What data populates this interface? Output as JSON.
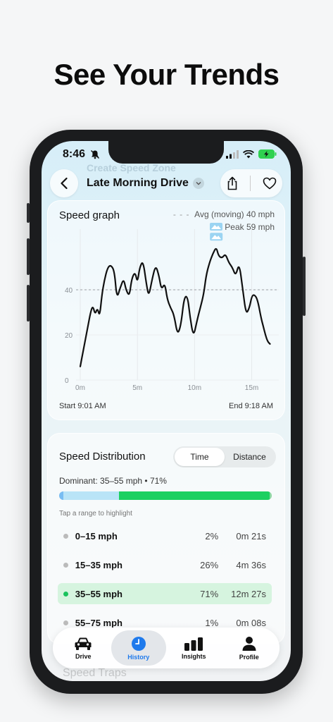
{
  "headline": "See Your Trends",
  "status": {
    "time": "8:46"
  },
  "ghost": {
    "top": "Create Speed Zone",
    "bottom": "Speed Traps"
  },
  "nav": {
    "title": "Late Morning Drive"
  },
  "graph": {
    "title": "Speed graph",
    "avg_label": "Avg (moving) 40 mph",
    "peak_label": "Peak 59 mph",
    "start_label": "Start 9:01 AM",
    "end_label": "End 9:18 AM"
  },
  "chart_data": {
    "type": "line",
    "xlabel": "",
    "ylabel": "",
    "x_ticks": [
      "0m",
      "5m",
      "10m",
      "15m"
    ],
    "y_ticks": [
      "0",
      "20",
      "40"
    ],
    "ylim": [
      0,
      60
    ],
    "xlim": [
      0,
      17
    ],
    "avg": 40,
    "peak": 59,
    "series": [
      {
        "x": [
          0,
          0.3,
          0.6,
          0.9,
          1.1,
          1.3,
          1.5,
          1.7,
          1.9,
          2.1,
          2.4,
          2.7,
          3.0,
          3.2,
          3.5,
          3.8,
          4.0,
          4.3,
          4.5,
          4.8,
          5.0,
          5.2,
          5.5,
          5.8,
          6.0,
          6.3,
          6.6,
          6.9,
          7.1,
          7.4,
          7.6,
          7.9,
          8.2,
          8.5,
          8.8,
          9.1,
          9.4,
          9.6,
          9.9,
          10.2,
          10.5,
          10.8,
          11.0,
          11.3,
          11.6,
          11.9,
          12.1,
          12.4,
          12.7,
          13.0,
          13.3,
          13.6,
          13.9,
          14.2,
          14.5,
          14.8,
          15.0,
          15.2,
          15.5,
          15.8,
          16.0,
          16.2,
          16.4,
          16.6
        ],
        "y": [
          6,
          14,
          22,
          30,
          33,
          29,
          32,
          28,
          38,
          44,
          50,
          51,
          48,
          36,
          41,
          45,
          40,
          37,
          45,
          48,
          43,
          50,
          53,
          42,
          37,
          45,
          51,
          46,
          40,
          43,
          36,
          32,
          29,
          20,
          24,
          37,
          37,
          28,
          19,
          26,
          32,
          38,
          46,
          52,
          56,
          59,
          55,
          54,
          56,
          52,
          50,
          46,
          52,
          41,
          29,
          32,
          37,
          38,
          36,
          28,
          24,
          20,
          17,
          16
        ]
      }
    ]
  },
  "distribution": {
    "title": "Speed Distribution",
    "toggle": [
      "Time",
      "Distance"
    ],
    "dominant": "Dominant: 35–55 mph • 71%",
    "hint": "Tap a range to highlight",
    "fractions": [
      0.02,
      0.26,
      0.71,
      0.01
    ],
    "colors": [
      "#79bdf2",
      "#b9e4f7",
      "#1cd061",
      "#8ed7a3"
    ],
    "rows": [
      {
        "label": "0–15 mph",
        "pct": "2%",
        "dur": "0m 21s"
      },
      {
        "label": "15–35 mph",
        "pct": "26%",
        "dur": "4m 36s"
      },
      {
        "label": "35–55 mph",
        "pct": "71%",
        "dur": "12m 27s"
      },
      {
        "label": "55–75 mph",
        "pct": "1%",
        "dur": "0m 08s"
      }
    ]
  },
  "tabs": [
    {
      "label": "Drive",
      "icon": "car-icon"
    },
    {
      "label": "History",
      "icon": "clock-icon"
    },
    {
      "label": "Insights",
      "icon": "bar-chart-icon"
    },
    {
      "label": "Profile",
      "icon": "person-icon"
    }
  ]
}
